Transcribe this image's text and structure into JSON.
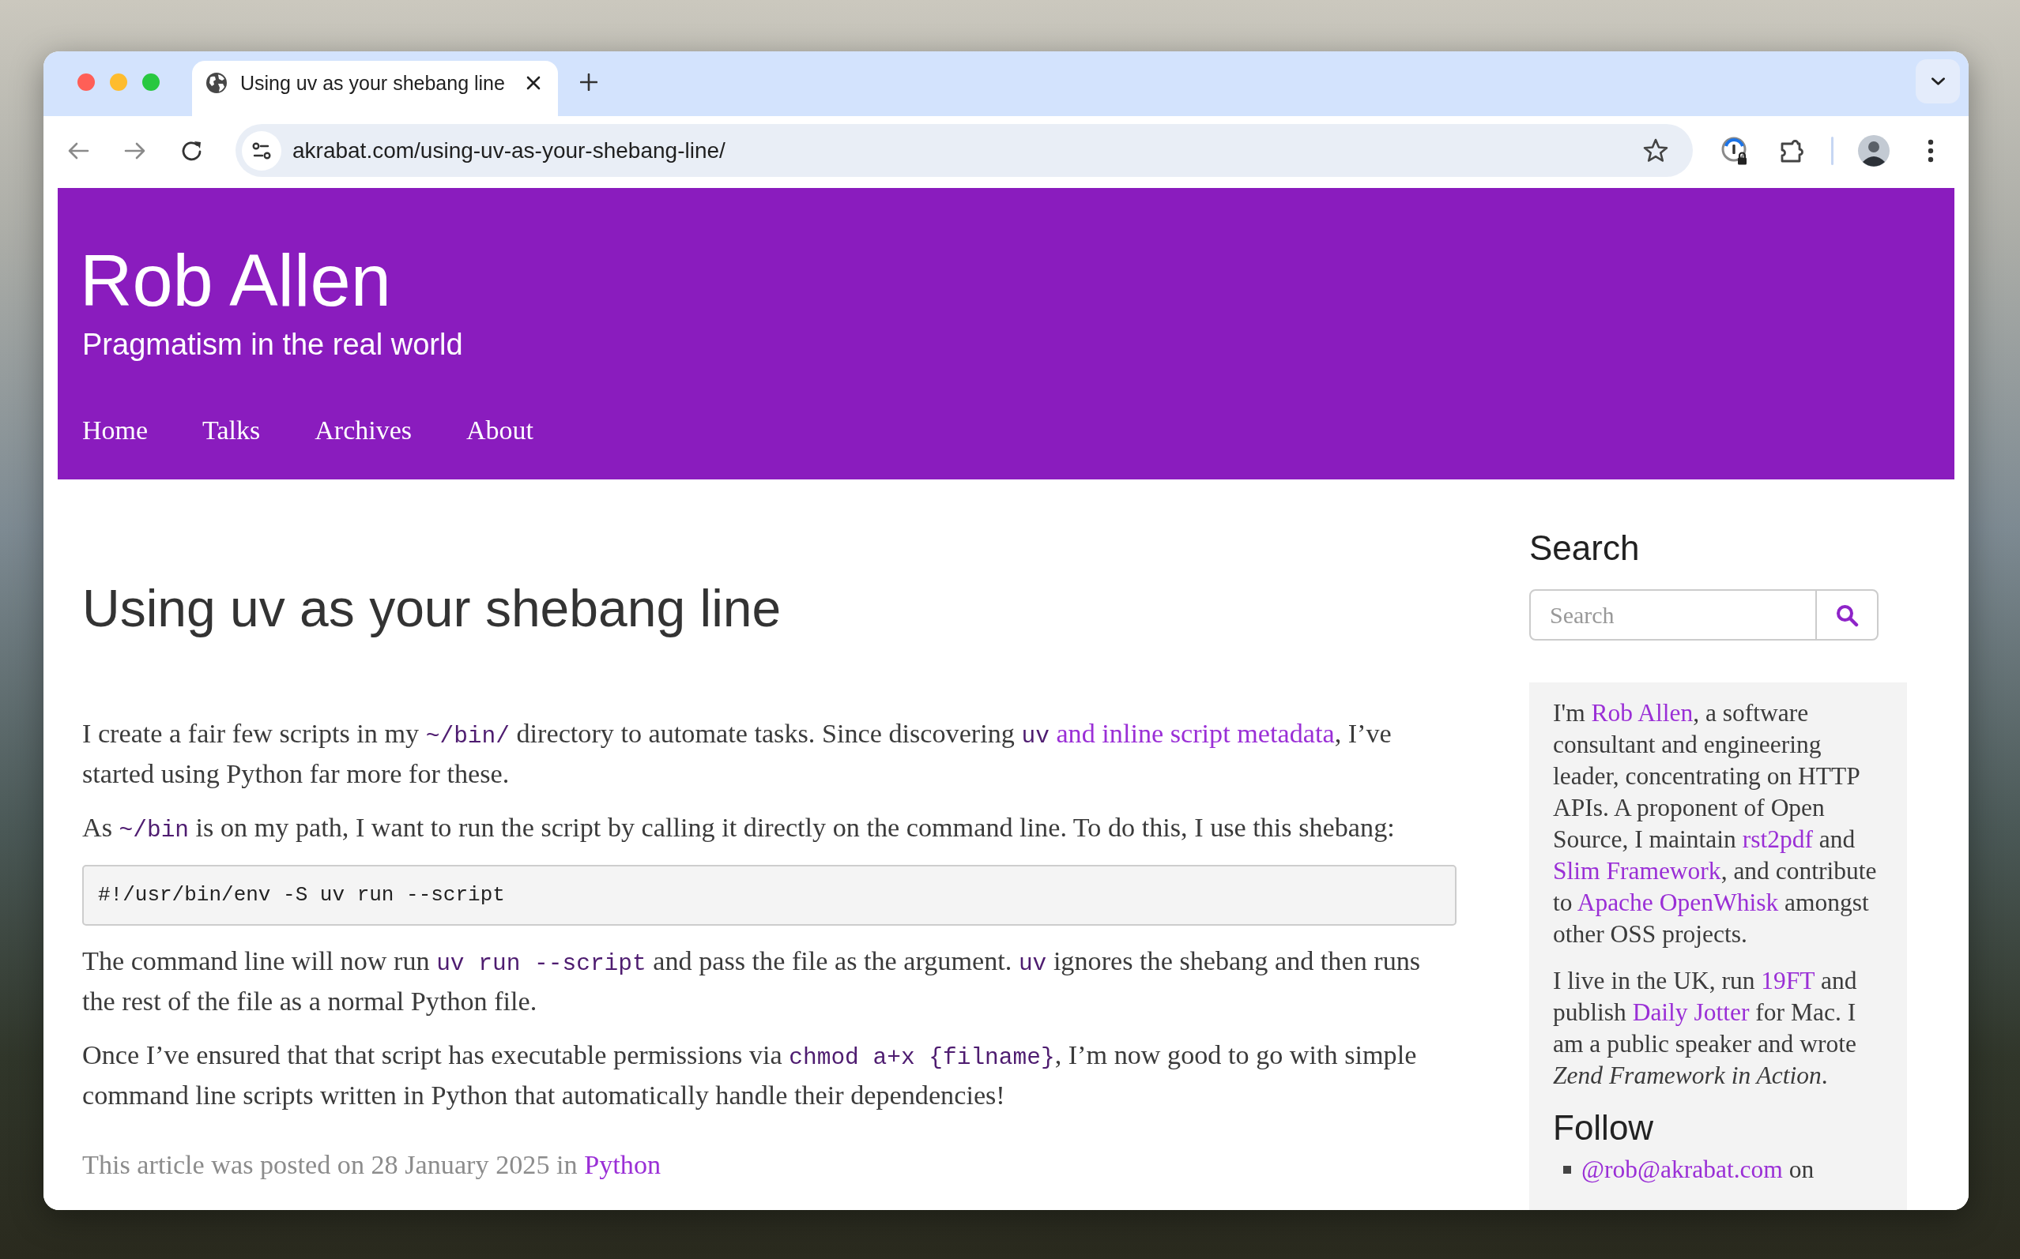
{
  "browser": {
    "tabs": [
      {
        "title": "Using uv as your shebang line",
        "selected": true
      }
    ],
    "address": "akrabat.com/using-uv-as-your-shebang-line/"
  },
  "site": {
    "title": "Rob Allen",
    "tagline": "Pragmatism in the real world",
    "nav": [
      "Home",
      "Talks",
      "Archives",
      "About"
    ]
  },
  "article": {
    "title": "Using uv as your shebang line",
    "blocks": [
      {
        "kind": "paragraph",
        "runs": [
          {
            "kind": "text",
            "text": "I create a fair few scripts in my "
          },
          {
            "kind": "code",
            "text": "~/bin/"
          },
          {
            "kind": "text",
            "text": " directory to automate tasks. Since discovering "
          },
          {
            "kind": "link",
            "code": "uv",
            "text": "and inline script metadata"
          },
          {
            "kind": "text",
            "text": ", I’ve started using Python far more for these."
          }
        ]
      },
      {
        "kind": "paragraph",
        "runs": [
          {
            "kind": "text",
            "text": "As "
          },
          {
            "kind": "code",
            "text": "~/bin"
          },
          {
            "kind": "text",
            "text": " is on my path, I want to run the script by calling it directly on the command line. To do this, I use this shebang:"
          }
        ]
      },
      {
        "kind": "code",
        "text": "#!/usr/bin/env -S uv run --script"
      },
      {
        "kind": "paragraph",
        "runs": [
          {
            "kind": "text",
            "text": "The command line will now run "
          },
          {
            "kind": "code",
            "text": "uv run --script"
          },
          {
            "kind": "text",
            "text": " and pass the file as the argument. "
          },
          {
            "kind": "code",
            "text": "uv"
          },
          {
            "kind": "text",
            "text": " ignores the shebang and then runs the rest of the file as a normal Python file."
          }
        ]
      },
      {
        "kind": "paragraph",
        "runs": [
          {
            "kind": "text",
            "text": "Once I’ve ensured that that script has executable permissions via "
          },
          {
            "kind": "code",
            "text": "chmod a+x {filname}"
          },
          {
            "kind": "text",
            "text": ", I’m now good to go with simple command line scripts written in Python that automatically handle their dependencies!"
          }
        ]
      }
    ],
    "meta": {
      "text": "This article was posted on 28 January 2025 in",
      "category": "Python"
    }
  },
  "sidebar": {
    "search": {
      "title": "Search",
      "placeholder": "Search"
    },
    "about": [
      {
        "runs": [
          {
            "kind": "text",
            "text": "I'm "
          },
          {
            "kind": "link",
            "text": "Rob Allen"
          },
          {
            "kind": "text",
            "text": ", a software consultant and engineering leader, concentrating on HTTP APIs. A proponent of Open Source, I maintain "
          },
          {
            "kind": "link",
            "text": "rst2pdf"
          },
          {
            "kind": "text",
            "text": " and "
          },
          {
            "kind": "link",
            "text": "Slim Framework"
          },
          {
            "kind": "text",
            "text": ", and contribute to "
          },
          {
            "kind": "link",
            "text": "Apache OpenWhisk"
          },
          {
            "kind": "text",
            "text": " amongst other OSS projects."
          }
        ]
      },
      {
        "runs": [
          {
            "kind": "text",
            "text": "I live in the UK, run "
          },
          {
            "kind": "link",
            "text": "19FT"
          },
          {
            "kind": "text",
            "text": " and publish "
          },
          {
            "kind": "link",
            "text": "Daily Jotter"
          },
          {
            "kind": "text",
            "text": " for Mac. I am a public speaker and wrote *Zend Framework in Action*."
          }
        ]
      }
    ],
    "follow": {
      "title": "Follow",
      "items": [
        {
          "handle": "@rob@akrabat.com",
          "suffix": "on"
        }
      ]
    }
  }
}
